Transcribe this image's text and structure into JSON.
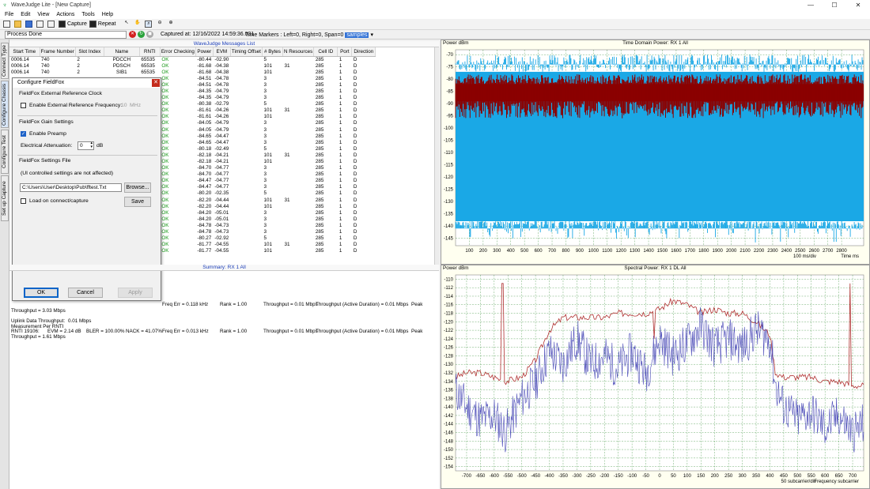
{
  "app": {
    "title": "WaveJudge Lite - [New Capture]",
    "minimize": "—",
    "maximize": "☐",
    "close": "✕"
  },
  "menu": [
    "File",
    "Edit",
    "View",
    "Actions",
    "Tools",
    "Help"
  ],
  "toolbar": {
    "capture_label": "Capture",
    "repeat_label": "Repeat"
  },
  "status": {
    "process": "Process Done",
    "captured_at": "Captured at: 12/16/2022 14:59:36.031",
    "time_markers": "Time Markers : Left=0, Right=0, Span=0",
    "span_unit": "samples"
  },
  "side_tabs": [
    "Connect Type",
    "Configure Chassis",
    "Configure Test",
    "Set up Capture"
  ],
  "messages": {
    "title": "WaveJudge Messages List",
    "columns": [
      "Start Time",
      "Frame Number",
      "Slot Index",
      "Name",
      "RNTI",
      "Error Checking",
      "Power",
      "EVM",
      "Timing Offset",
      "# Bytes",
      "N Resources",
      "Cell ID",
      "Port",
      "Direction"
    ],
    "rows": [
      [
        "0006.14",
        "740",
        "2",
        "PDCCH",
        "65535",
        "OK",
        "-80.44",
        "-02.90",
        "",
        "5",
        "",
        "285",
        "1",
        "D"
      ],
      [
        "0006.14",
        "740",
        "2",
        "PDSCH",
        "65535",
        "OK",
        "-81.68",
        "-04.38",
        "",
        "101",
        "31",
        "285",
        "1",
        "D"
      ],
      [
        "0006.14",
        "740",
        "2",
        "SIB1",
        "65535",
        "OK",
        "-81.68",
        "-04.38",
        "",
        "101",
        "",
        "285",
        "1",
        "D"
      ],
      [
        "",
        "",
        "",
        "",
        "",
        "OK",
        "-84.51",
        "-04.78",
        "",
        "3",
        "",
        "285",
        "1",
        "D"
      ],
      [
        "",
        "",
        "",
        "",
        "",
        "OK",
        "-84.51",
        "-04.78",
        "",
        "3",
        "",
        "285",
        "1",
        "D"
      ],
      [
        "",
        "",
        "",
        "",
        "",
        "OK",
        "-84.35",
        "-04.79",
        "",
        "3",
        "",
        "285",
        "1",
        "D"
      ],
      [
        "",
        "",
        "",
        "",
        "",
        "OK",
        "-84.35",
        "-04.79",
        "",
        "3",
        "",
        "285",
        "1",
        "D"
      ],
      [
        "",
        "",
        "",
        "",
        "",
        "OK",
        "-80.38",
        "-02.79",
        "",
        "5",
        "",
        "285",
        "1",
        "D"
      ],
      [
        "",
        "",
        "",
        "",
        "",
        "OK",
        "-81.61",
        "-04.26",
        "",
        "101",
        "31",
        "285",
        "1",
        "D"
      ],
      [
        "",
        "",
        "",
        "",
        "",
        "OK",
        "-81.61",
        "-04.26",
        "",
        "101",
        "",
        "285",
        "1",
        "D"
      ],
      [
        "",
        "",
        "",
        "",
        "",
        "OK",
        "-84.05",
        "-04.79",
        "",
        "3",
        "",
        "285",
        "1",
        "D"
      ],
      [
        "",
        "",
        "",
        "",
        "",
        "OK",
        "-84.05",
        "-04.79",
        "",
        "3",
        "",
        "285",
        "1",
        "D"
      ],
      [
        "",
        "",
        "",
        "",
        "",
        "OK",
        "-84.65",
        "-04.47",
        "",
        "3",
        "",
        "285",
        "1",
        "D"
      ],
      [
        "",
        "",
        "",
        "",
        "",
        "OK",
        "-84.65",
        "-04.47",
        "",
        "3",
        "",
        "285",
        "1",
        "D"
      ],
      [
        "",
        "",
        "",
        "",
        "",
        "OK",
        "-80.18",
        "-02.49",
        "",
        "5",
        "",
        "285",
        "1",
        "D"
      ],
      [
        "",
        "",
        "",
        "",
        "",
        "OK",
        "-82.18",
        "-04.21",
        "",
        "101",
        "31",
        "285",
        "1",
        "D"
      ],
      [
        "",
        "",
        "",
        "",
        "",
        "OK",
        "-82.18",
        "-04.21",
        "",
        "101",
        "",
        "285",
        "1",
        "D"
      ],
      [
        "",
        "",
        "",
        "",
        "",
        "OK",
        "-84.70",
        "-04.77",
        "",
        "3",
        "",
        "285",
        "1",
        "D"
      ],
      [
        "",
        "",
        "",
        "",
        "",
        "OK",
        "-84.70",
        "-04.77",
        "",
        "3",
        "",
        "285",
        "1",
        "D"
      ],
      [
        "",
        "",
        "",
        "",
        "",
        "OK",
        "-84.47",
        "-04.77",
        "",
        "3",
        "",
        "285",
        "1",
        "D"
      ],
      [
        "",
        "",
        "",
        "",
        "",
        "OK",
        "-84.47",
        "-04.77",
        "",
        "3",
        "",
        "285",
        "1",
        "D"
      ],
      [
        "",
        "",
        "",
        "",
        "",
        "OK",
        "-80.20",
        "-02.35",
        "",
        "5",
        "",
        "285",
        "1",
        "D"
      ],
      [
        "",
        "",
        "",
        "",
        "",
        "OK",
        "-82.20",
        "-04.44",
        "",
        "101",
        "31",
        "285",
        "1",
        "D"
      ],
      [
        "",
        "",
        "",
        "",
        "",
        "OK",
        "-82.20",
        "-04.44",
        "",
        "101",
        "",
        "285",
        "1",
        "D"
      ],
      [
        "",
        "",
        "",
        "",
        "",
        "OK",
        "-84.20",
        "-05.01",
        "",
        "3",
        "",
        "285",
        "1",
        "D"
      ],
      [
        "",
        "",
        "",
        "",
        "",
        "OK",
        "-84.20",
        "-05.01",
        "",
        "3",
        "",
        "285",
        "1",
        "D"
      ],
      [
        "",
        "",
        "",
        "",
        "",
        "OK",
        "-84.78",
        "-04.73",
        "",
        "3",
        "",
        "285",
        "1",
        "D"
      ],
      [
        "",
        "",
        "",
        "",
        "",
        "OK",
        "-84.78",
        "-04.73",
        "",
        "3",
        "",
        "285",
        "1",
        "D"
      ],
      [
        "",
        "",
        "",
        "",
        "",
        "OK",
        "-80.27",
        "-02.92",
        "",
        "5",
        "",
        "285",
        "1",
        "D"
      ],
      [
        "",
        "",
        "",
        "",
        "",
        "OK",
        "-81.77",
        "-04.55",
        "",
        "101",
        "31",
        "285",
        "1",
        "D"
      ],
      [
        "",
        "",
        "",
        "",
        "",
        "OK",
        "-81.77",
        "-04.55",
        "",
        "101",
        "",
        "285",
        "1",
        "D"
      ]
    ]
  },
  "summary": {
    "title": "Summary: RX 1 All",
    "line1": [
      "Freq Err = 0.118 kHz",
      "Rank = 1.00",
      "Throughput = 0.01 Mbps",
      "Throughput (Active Duration) = 0.01 Mbps",
      "Peak"
    ],
    "throughput_dl": "Throughput = 3.03 Mbps",
    "uplink_label": "Uplink Data Throughput:",
    "uplink_value": "0.01 Mbps",
    "measure_label": "Measurement Per RNTI",
    "rnti_line": [
      "RNTI 19106:",
      "EVM = 2.14 dB",
      "BLER = 100.00%",
      "NACK = 41.07%",
      "Freq Err = 0.013 kHz",
      "Rank = 1.00",
      "Throughput = 0.01 Mbps",
      "Throughput (Active Duration) = 0.01 Mbps",
      "Peak"
    ],
    "throughput_ul": "Throughput = 1.61 Mbps"
  },
  "dialog": {
    "title": "Configure FieldFox",
    "sec1": "FieldFox External Reference Clock",
    "ext_ref_label": "Enable External Reference Frequency:",
    "ext_ref_value": "10",
    "ext_ref_unit": "MHz",
    "sec2": "FieldFox Gain Settings",
    "preamp_label": "Enable Preamp",
    "atten_label": "Electrical Attenuation:",
    "atten_value": "0",
    "atten_unit": "dB",
    "sec3": "FieldFox Settings File",
    "note": "(UI controlled settings are not affected)",
    "file_path": "C:\\Users\\User\\Desktop\\Pub\\fftest.Txt",
    "browse": "Browse...",
    "load_label": "Load on connect/capture",
    "save": "Save",
    "ok": "OK",
    "cancel": "Cancel",
    "apply": "Apply"
  },
  "chart_data": [
    {
      "type": "line",
      "title": "Time Domain Power: RX 1 All",
      "ylabel": "Power dBm",
      "xlabel": "Time ms",
      "x_scale_note": "100 ms/div",
      "ylim": [
        -148,
        -68
      ],
      "yticks": [
        -70,
        -75,
        -80,
        -85,
        -90,
        -95,
        -100,
        -105,
        -110,
        -115,
        -120,
        -125,
        -130,
        -135,
        -140,
        -145
      ],
      "xlim": [
        0,
        2960
      ],
      "xticks": [
        100,
        200,
        300,
        400,
        500,
        600,
        700,
        800,
        900,
        1000,
        1100,
        1200,
        1300,
        1400,
        1500,
        1600,
        1700,
        1800,
        1900,
        2000,
        2100,
        2200,
        2300,
        2400,
        2500,
        2600,
        2700,
        2800
      ],
      "series": [
        {
          "color": "#1aa8e6",
          "band_top": -77,
          "band_bottom": -138,
          "spike_min": -148,
          "spike_max": -70
        },
        {
          "color": "#8b0000",
          "band_top": -82,
          "band_bottom": -89,
          "spike_min": -96,
          "spike_max": -78
        }
      ]
    },
    {
      "type": "line",
      "title": "Spectral Power: RX 1 DL All",
      "ylabel": "Power dBm",
      "xlabel": "Frequency subcarrier",
      "x_scale_note": "50 subcarrier/div",
      "ylim": [
        -155,
        -109
      ],
      "yticks": [
        -110,
        -112,
        -114,
        -116,
        -118,
        -120,
        -122,
        -124,
        -126,
        -128,
        -130,
        -132,
        -134,
        -136,
        -138,
        -140,
        -142,
        -144,
        -146,
        -148,
        -150,
        -152,
        -154
      ],
      "xlim": [
        -740,
        740
      ],
      "xticks": [
        -700,
        -650,
        -600,
        -550,
        -500,
        -450,
        -400,
        -350,
        -300,
        -250,
        -200,
        -150,
        -100,
        -50,
        0,
        50,
        100,
        150,
        200,
        250,
        300,
        350,
        400,
        450,
        500,
        550,
        600,
        650,
        700
      ],
      "series": [
        {
          "color": "#b03030",
          "points": [
            [
              -740,
              -133
            ],
            [
              -700,
              -132
            ],
            [
              -650,
              -132
            ],
            [
              -600,
              -133
            ],
            [
              -560,
              -134
            ],
            [
              -500,
              -133
            ],
            [
              -450,
              -129
            ],
            [
              -400,
              -122
            ],
            [
              -350,
              -119
            ],
            [
              -300,
              -119
            ],
            [
              -250,
              -119
            ],
            [
              -200,
              -119
            ],
            [
              -150,
              -118
            ],
            [
              -100,
              -118
            ],
            [
              -50,
              -118
            ],
            [
              0,
              -117
            ],
            [
              50,
              -115
            ],
            [
              100,
              -116
            ],
            [
              150,
              -118
            ],
            [
              200,
              -117
            ],
            [
              250,
              -118
            ],
            [
              300,
              -118
            ],
            [
              350,
              -120
            ],
            [
              400,
              -123
            ],
            [
              420,
              -132
            ],
            [
              450,
              -133
            ],
            [
              500,
              -133
            ],
            [
              550,
              -133
            ],
            [
              600,
              -134
            ],
            [
              650,
              -134
            ],
            [
              700,
              -135
            ],
            [
              740,
              -135
            ]
          ]
        },
        {
          "color": "#4b4bb8",
          "points": [
            [
              -740,
              -136
            ],
            [
              -700,
              -140
            ],
            [
              -650,
              -143
            ],
            [
              -600,
              -142
            ],
            [
              -560,
              -146
            ],
            [
              -500,
              -138
            ],
            [
              -450,
              -134
            ],
            [
              -400,
              -127
            ],
            [
              -350,
              -130
            ],
            [
              -300,
              -124
            ],
            [
              -250,
              -130
            ],
            [
              -200,
              -128
            ],
            [
              -150,
              -131
            ],
            [
              -100,
              -127
            ],
            [
              -50,
              -132
            ],
            [
              0,
              -124
            ],
            [
              50,
              -128
            ],
            [
              100,
              -125
            ],
            [
              150,
              -121
            ],
            [
              200,
              -126
            ],
            [
              250,
              -124
            ],
            [
              300,
              -126
            ],
            [
              350,
              -122
            ],
            [
              400,
              -124
            ],
            [
              420,
              -135
            ],
            [
              450,
              -140
            ],
            [
              500,
              -143
            ],
            [
              550,
              -141
            ],
            [
              600,
              -145
            ],
            [
              650,
              -142
            ],
            [
              700,
              -146
            ],
            [
              740,
              -144
            ]
          ]
        }
      ]
    }
  ]
}
